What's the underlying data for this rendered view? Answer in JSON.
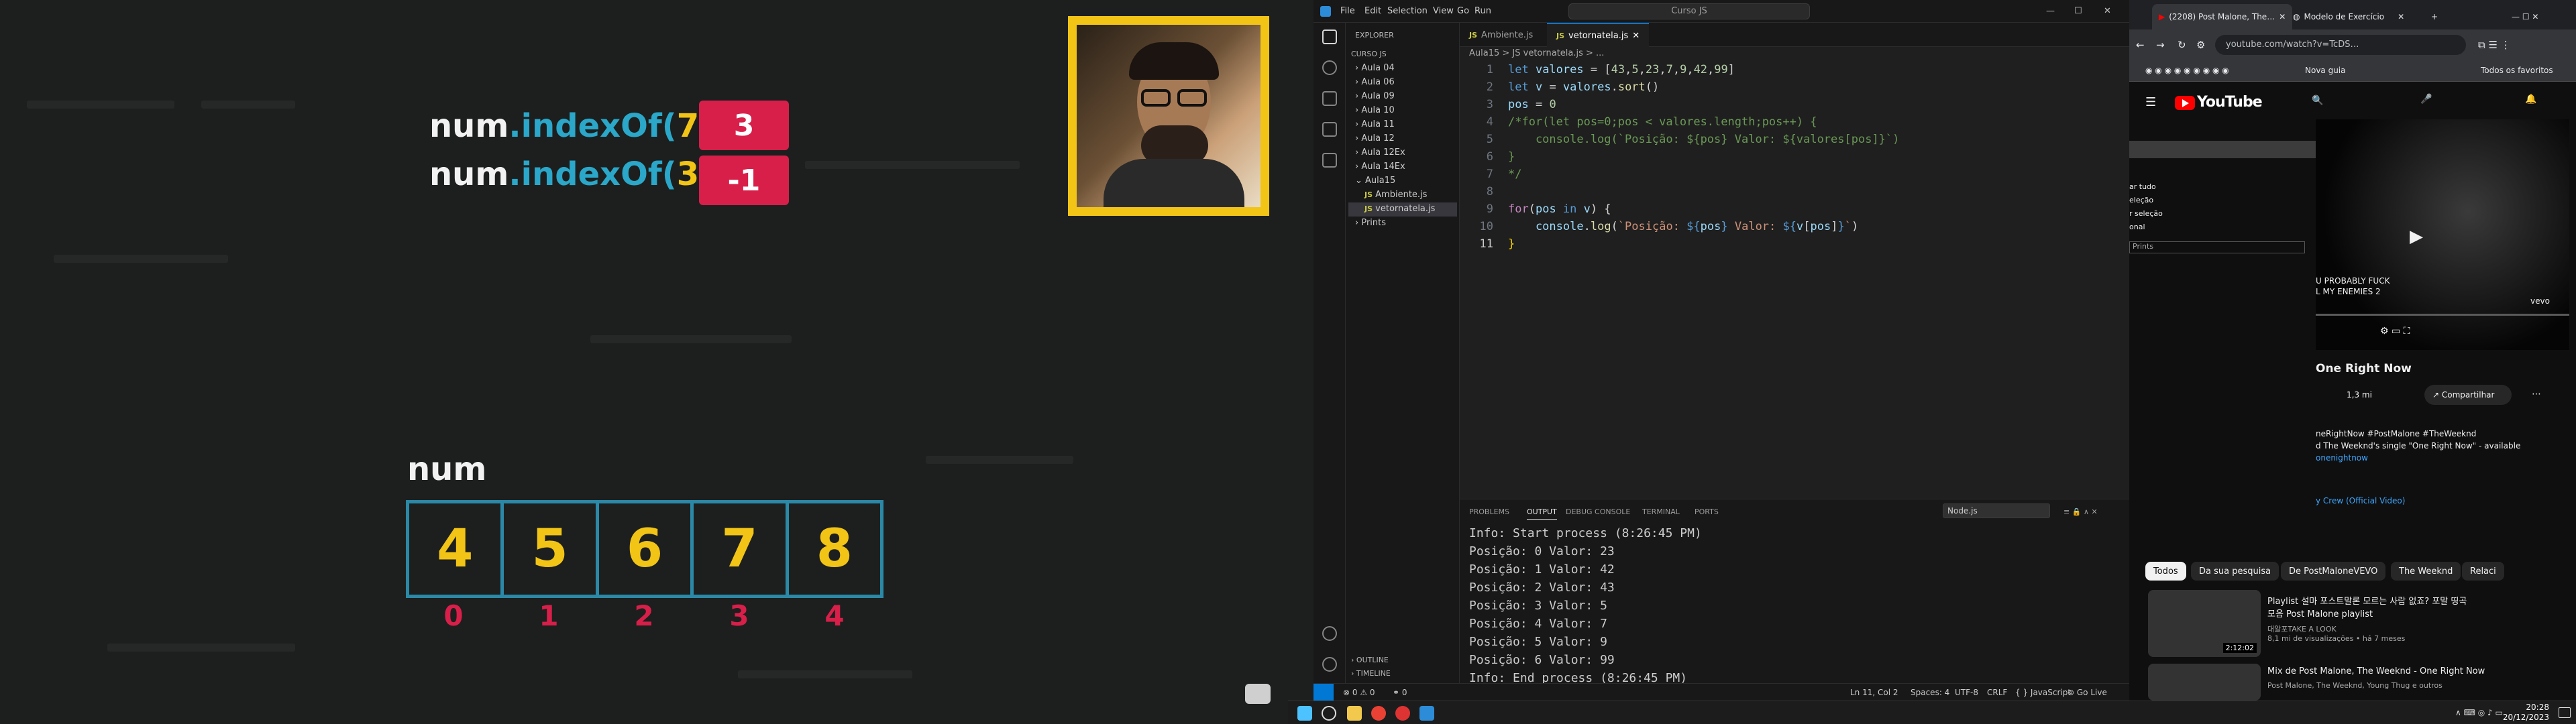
{
  "slide": {
    "expressions": [
      {
        "obj": "num",
        "method": ".indexOf(",
        "arg": "7",
        "close": ")",
        "result": "3"
      },
      {
        "obj": "num",
        "method": ".indexOf(",
        "arg": "3",
        "close": ")",
        "result": "-1"
      }
    ],
    "array_name": "num",
    "array_values": [
      "4",
      "5",
      "6",
      "7",
      "8"
    ],
    "array_indexes": [
      "0",
      "1",
      "2",
      "3",
      "4"
    ]
  },
  "vscode": {
    "menu": [
      "File",
      "Edit",
      "Selection",
      "View",
      "Go",
      "Run"
    ],
    "command_center": "Curso JS",
    "explorer_title": "EXPLORER",
    "root_folder": "CURSO JS",
    "folders": [
      "Aula 04",
      "Aula 06",
      "Aula 09",
      "Aula 10",
      "Aula 11",
      "Aula 12",
      "Aula 12Ex",
      "Aula 14Ex",
      "Aula15"
    ],
    "files": [
      "Ambiente.js",
      "vetornatela.js"
    ],
    "after_folder": "Prints",
    "tabs": [
      "Ambiente.js",
      "vetornatela.js"
    ],
    "breadcrumb": "Aula15 > JS vetornatela.js > ...",
    "outline": "OUTLINE",
    "timeline": "TIMELINE",
    "panel_tabs": [
      "PROBLEMS",
      "OUTPUT",
      "DEBUG CONSOLE",
      "TERMINAL",
      "PORTS"
    ],
    "output_channel": "Node.js",
    "output_lines": [
      "Info: Start process (8:26:45 PM)",
      "Posição: 0 Valor: 23",
      "Posição: 1 Valor: 42",
      "Posição: 2 Valor: 43",
      "Posição: 3 Valor: 5",
      "Posição: 4 Valor: 7",
      "Posição: 5 Valor: 9",
      "Posição: 6 Valor: 99",
      "Info: End process (8:26:45 PM)"
    ],
    "status": {
      "errors": "0",
      "warnings": "0",
      "ports": "0",
      "cursor": "Ln 11, Col 2",
      "spaces": "Spaces: 4",
      "encoding": "UTF-8",
      "eol": "CRLF",
      "language": "JavaScript",
      "golive": "Go Live"
    }
  },
  "chrome": {
    "tabs": [
      "(2208) Post Malone, The…",
      "Modelo de Exercício"
    ],
    "url": "youtube.com/watch?v=TcDS…",
    "bookmark": "Nova guia",
    "bookmarks_all": "Todos os favoritos",
    "video_overlay": [
      "U PROBABLY FUCK",
      "L MY ENEMIES 2"
    ],
    "video_title": "One Right Now",
    "likes": "1,3 mi",
    "share": "Compartilhar",
    "desc_line1": "neRightNow #PostMalone #TheWeeknd",
    "desc_line2": "d The Weeknd's single \"One Right Now\" - available",
    "desc_link": "onenightnow",
    "credits_link": "y Crew (Official Video)",
    "chips": [
      "Todos",
      "Da sua pesquisa",
      "De PostMaloneVEVO",
      "The Weeknd",
      "Relaci"
    ],
    "rec1_title": "Playlist 설마 포스트말론 모르는 사람 없죠? 포말 띵곡 모음 Post Malone playlist",
    "rec1_channel": "대알포TAKE A LOOK",
    "rec1_meta": "8,1 mi de visualizações • há 7 meses",
    "rec1_duration": "2:12:02",
    "rec2_title": "Mix de Post Malone, The Weeknd - One Right Now",
    "rec2_channel": "Post Malone, The Weeknd, Young Thug e outros",
    "overlay_items": [
      "ar tudo",
      "eleção",
      "r seleção",
      "onal"
    ],
    "overlay_search": "Prints"
  },
  "taskbar": {
    "time": "20:28",
    "date": "20/12/2023"
  }
}
